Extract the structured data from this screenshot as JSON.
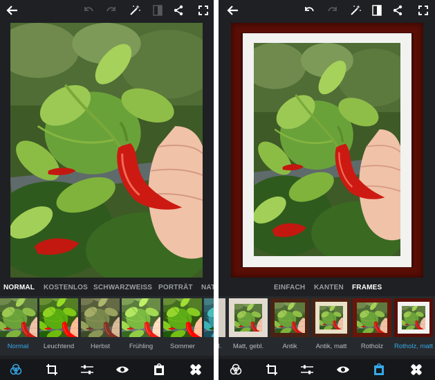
{
  "left_panel": {
    "tabs": [
      {
        "label": "NORMAL",
        "active": true
      },
      {
        "label": "KOSTENLOS",
        "active": false
      },
      {
        "label": "SCHWARZWEISS",
        "active": false
      },
      {
        "label": "PORTRÄT",
        "active": false
      },
      {
        "label": "NAT",
        "active": false
      }
    ],
    "filters": [
      {
        "label": "Normal",
        "selected": true
      },
      {
        "label": "Leuchtend",
        "selected": false
      },
      {
        "label": "Herbst",
        "selected": false
      },
      {
        "label": "Frühling",
        "selected": false
      },
      {
        "label": "Sommer",
        "selected": false
      },
      {
        "label": "",
        "selected": false
      }
    ],
    "active_tool": "filters"
  },
  "right_panel": {
    "tabs": [
      {
        "label": "EINFACH",
        "active": false
      },
      {
        "label": "KANTEN",
        "active": false
      },
      {
        "label": "FRAMES",
        "active": true
      }
    ],
    "frames": [
      {
        "label": "l.",
        "selected": false
      },
      {
        "label": "Matt, gebl.",
        "selected": false
      },
      {
        "label": "Antik",
        "selected": false
      },
      {
        "label": "Antik, matt",
        "selected": false
      },
      {
        "label": "Rotholz",
        "selected": false
      },
      {
        "label": "Rotholz, matt",
        "selected": true
      }
    ],
    "active_tool": "frames"
  },
  "colors": {
    "background": "#1e2023",
    "filmstrip": "#262a2e",
    "bottom_bar": "#15171a",
    "accent": "#37a8e8",
    "frame_wood": "#5a0e06",
    "frame_mat": "#f2f2f0"
  },
  "icons": [
    "back-arrow-icon",
    "undo-icon",
    "redo-icon",
    "magic-wand-icon",
    "compare-icon",
    "share-icon",
    "fullscreen-icon",
    "filters-icon",
    "crop-icon",
    "adjust-sliders-icon",
    "eye-icon",
    "frame-icon",
    "healing-bandage-icon"
  ]
}
